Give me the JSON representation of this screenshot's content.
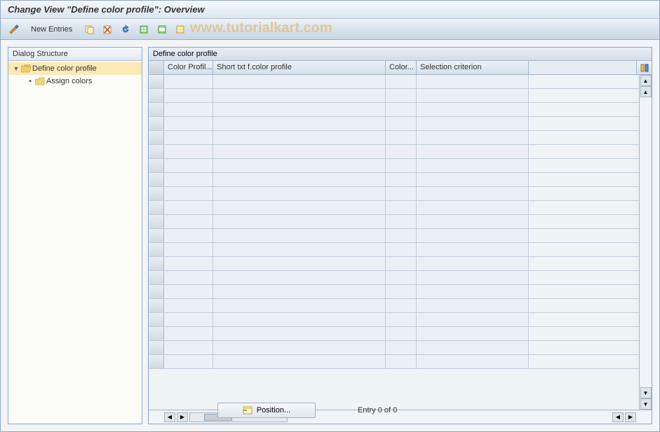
{
  "title": "Change View \"Define color profile\": Overview",
  "watermark": "www.tutorialkart.com",
  "toolbar": {
    "new_entries": "New Entries"
  },
  "tree": {
    "header": "Dialog Structure",
    "items": [
      {
        "label": "Define color profile",
        "selected": true,
        "open": true
      },
      {
        "label": "Assign colors",
        "selected": false,
        "open": false
      }
    ]
  },
  "grid": {
    "title": "Define color profile",
    "columns": {
      "col1": "Color Profil...",
      "col2": "Short txt f.color profile",
      "col3": "Color...",
      "col4": "Selection criterion"
    }
  },
  "footer": {
    "position_btn": "Position...",
    "entry_text": "Entry 0 of 0"
  }
}
